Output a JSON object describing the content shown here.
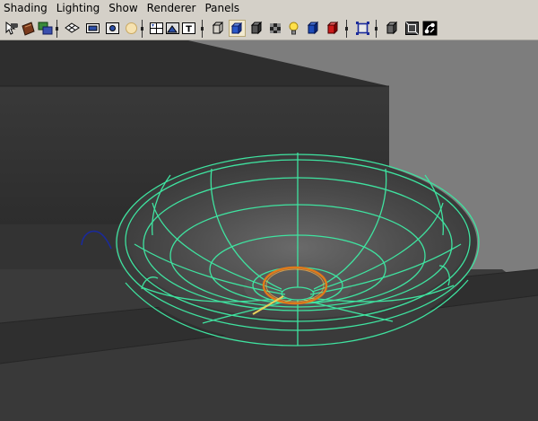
{
  "menubar": {
    "items": [
      "Shading",
      "Lighting",
      "Show",
      "Renderer",
      "Panels"
    ]
  },
  "toolbar": {
    "buttons": [
      {
        "id": "select-camera",
        "icon": "camera-select-icon"
      },
      {
        "id": "camera-attributes",
        "icon": "camera-attributes-icon"
      },
      {
        "id": "bookmarks",
        "icon": "bookmark-icon"
      },
      {
        "id": "grid",
        "icon": "grid-icon"
      },
      {
        "id": "film-gate",
        "icon": "film-gate-icon"
      },
      {
        "id": "resolution-gate",
        "icon": "resolution-gate-icon"
      },
      {
        "id": "gate-mask",
        "icon": "gate-mask-icon"
      },
      {
        "id": "field-chart",
        "icon": "field-chart-icon"
      },
      {
        "id": "safe-action",
        "icon": "safe-action-icon"
      },
      {
        "id": "safe-title",
        "icon": "safe-title-icon"
      },
      {
        "id": "wireframe",
        "icon": "wireframe-cube-icon"
      },
      {
        "id": "smooth-shade",
        "icon": "smooth-shade-cube-icon",
        "active": true
      },
      {
        "id": "wireframe-on-shaded",
        "icon": "wireframe-on-shaded-icon"
      },
      {
        "id": "textured",
        "icon": "textured-icon"
      },
      {
        "id": "use-all-lights",
        "icon": "light-bulb-icon"
      },
      {
        "id": "shadows",
        "icon": "shadow-cube-icon"
      },
      {
        "id": "high-quality",
        "icon": "high-quality-cube-icon"
      },
      {
        "id": "isolate-select",
        "icon": "isolate-select-icon"
      },
      {
        "id": "xray",
        "icon": "xray-icon"
      },
      {
        "id": "xray-joints",
        "icon": "xray-joints-icon"
      },
      {
        "id": "component-display",
        "icon": "component-display-icon"
      }
    ]
  },
  "colors": {
    "menubar_bg": "#d4d0c8",
    "viewport_bg": "#7d7d7d",
    "wireframe_highlight": "#3fe3a0",
    "manipulator_orange": "#e07a1a",
    "curve_blue": "#1a2a9a"
  }
}
